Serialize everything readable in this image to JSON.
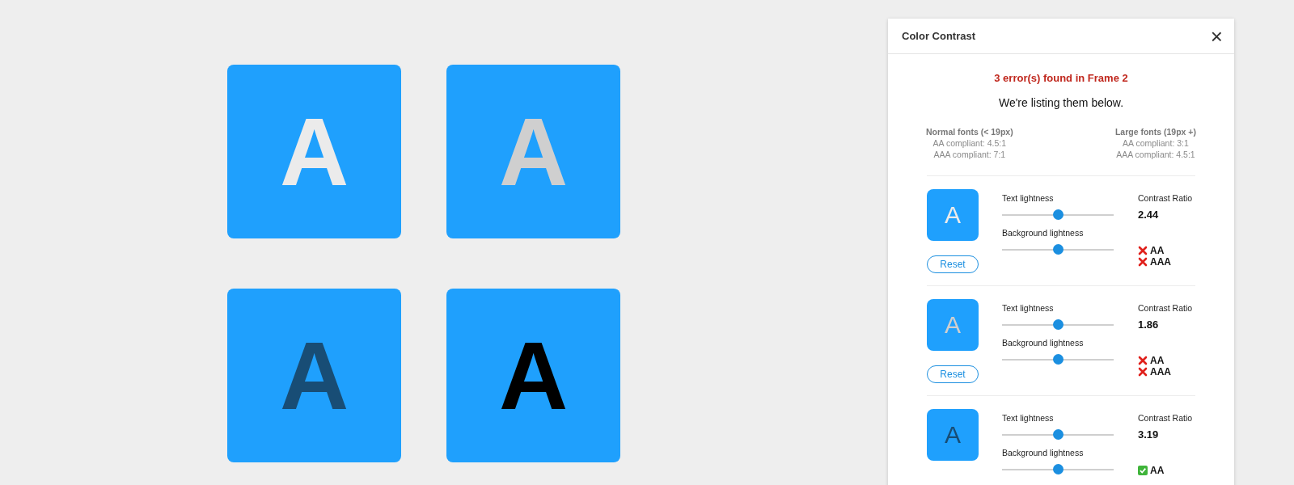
{
  "canvas": {
    "tiles": [
      {
        "letter": "A",
        "color": "#ebebeb"
      },
      {
        "letter": "A",
        "color": "#cfcfcf"
      },
      {
        "letter": "A",
        "color": "#184d75"
      },
      {
        "letter": "A",
        "color": "#000000"
      }
    ]
  },
  "panel": {
    "title": "Color Contrast",
    "close": "×",
    "summary": "3 error(s) found in Frame 2",
    "subtitle": "We're listing them below.",
    "legend": [
      {
        "heading": "Normal fonts (< 19px)",
        "lines": [
          "AA compliant: 4.5:1",
          "AAA compliant: 7:1"
        ]
      },
      {
        "heading": "Large fonts (19px +)",
        "lines": [
          "AA compliant: 3:1",
          "AAA compliant: 4.5:1"
        ]
      }
    ],
    "errors": [
      {
        "letter": "A",
        "color": "#ebebeb",
        "reset": "Reset",
        "sliders": [
          {
            "label": "Text lightness",
            "level": 0.5
          },
          {
            "label": "Background lightness",
            "level": 0.5
          }
        ],
        "ratio_label": "Contrast Ratio",
        "ratio": "2.44",
        "checks": [
          {
            "kind": "fail",
            "label": "AA"
          },
          {
            "kind": "fail",
            "label": "AAA"
          }
        ]
      },
      {
        "letter": "A",
        "color": "#cfcfcf",
        "reset": "Reset",
        "sliders": [
          {
            "label": "Text lightness",
            "level": 0.5
          },
          {
            "label": "Background lightness",
            "level": 0.5
          }
        ],
        "ratio_label": "Contrast Ratio",
        "ratio": "1.86",
        "checks": [
          {
            "kind": "fail",
            "label": "AA"
          },
          {
            "kind": "fail",
            "label": "AAA"
          }
        ]
      },
      {
        "letter": "A",
        "color": "#184d75",
        "sliders": [
          {
            "label": "Text lightness",
            "level": 0.5
          },
          {
            "label": "Background lightness",
            "level": 0.5
          }
        ],
        "ratio_label": "Contrast Ratio",
        "ratio": "3.19",
        "checks": [
          {
            "kind": "pass",
            "label": "AA"
          }
        ]
      }
    ]
  }
}
